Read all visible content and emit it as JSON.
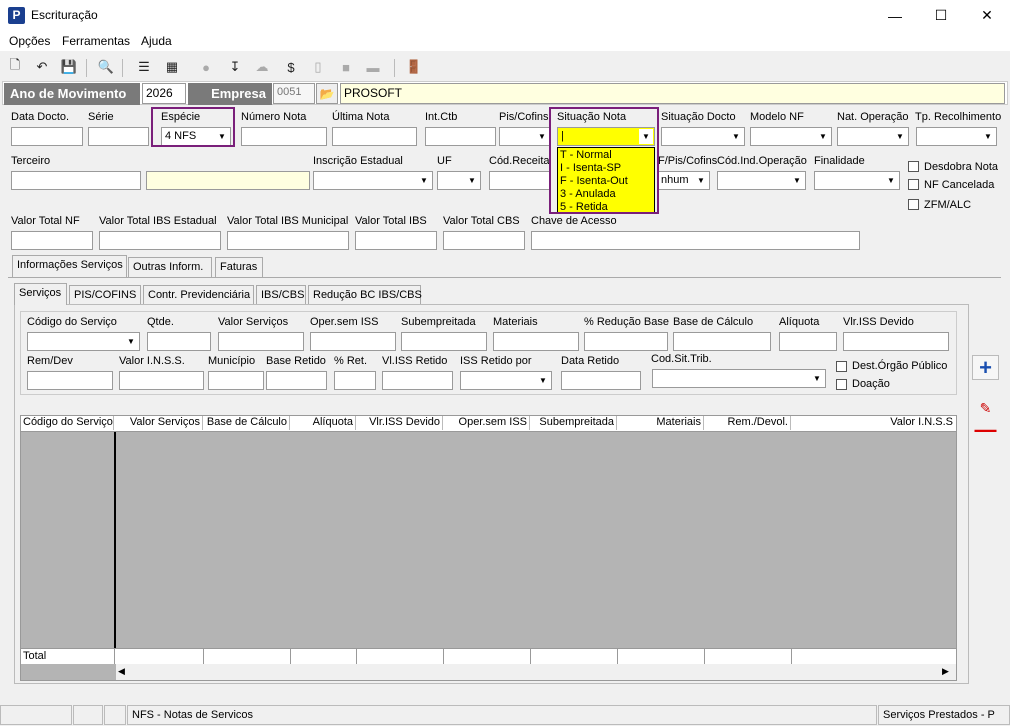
{
  "window": {
    "title": "Escrituração",
    "icon": "P"
  },
  "menu": [
    "Opções",
    "Ferramentas",
    "Ajuda"
  ],
  "header": {
    "ano_label": "Ano de Movimento",
    "ano_value": "2026",
    "empresa_label": "Empresa",
    "empresa_code": "0051",
    "empresa_name": "PROSOFT"
  },
  "row1": {
    "data_docto": "Data Docto.",
    "serie": "Série",
    "especie": "Espécie",
    "especie_value": "4 NFS",
    "numero_nota": "Número Nota",
    "ultima_nota": "Última Nota",
    "int_ctb": "Int.Ctb",
    "pis_cofins": "Pis/Cofins",
    "situacao_nota": "Situação Nota",
    "situacao_value": "|",
    "situacao_docto": "Situação Docto",
    "modelo_nf": "Modelo NF",
    "nat_operacao": "Nat. Operação",
    "tp_recolhimento": "Tp. Recolhimento"
  },
  "situacao_options": [
    "T - Normal",
    "I - Isenta-SP",
    "F - Isenta-Out",
    "3 - Anulada",
    "5 - Retida"
  ],
  "row2": {
    "terceiro": "Terceiro",
    "inscricao_estadual": "Inscrição Estadual",
    "uf": "UF",
    "cod_receita": "Cód.Receita",
    "f_pis_cofins": "F/Pis/Cofins",
    "f_pis_value": "nhum",
    "cod_ind_operacao": "Cód.Ind.Operação",
    "finalidade": "Finalidade"
  },
  "checks": {
    "desdobra_nota": "Desdobra Nota",
    "nf_cancelada": "NF Cancelada",
    "zfm_alc": "ZFM/ALC"
  },
  "row3": {
    "valor_total_nf": "Valor Total NF",
    "valor_total_ibs_estadual": "Valor Total IBS Estadual",
    "valor_total_ibs_municipal": "Valor Total IBS Municipal",
    "valor_total_ibs": "Valor Total IBS",
    "valor_total_cbs": "Valor Total CBS",
    "chave_acesso": "Chave de Acesso"
  },
  "main_tabs": [
    "Informações Serviços",
    "Outras Inform.",
    "Faturas"
  ],
  "sub_tabs": [
    "Serviços",
    "PIS/COFINS",
    "Contr. Previdenciária",
    "IBS/CBS",
    "Redução BC IBS/CBS"
  ],
  "servicos": {
    "codigo_servico": "Código do Serviço",
    "qtde": "Qtde.",
    "valor_servicos": "Valor Serviços",
    "oper_sem_iss": "Oper.sem ISS",
    "subempreitada": "Subempreitada",
    "materiais": "Materiais",
    "pct_reducao_base": "% Redução Base",
    "base_calculo": "Base de Cálculo",
    "aliquota": "Alíquota",
    "vlr_iss_devido": "Vlr.ISS Devido",
    "rem_dev": "Rem/Dev",
    "valor_inss": "Valor I.N.S.S.",
    "municipio": "Município",
    "base_retido": "Base Retido",
    "pct_ret": "% Ret.",
    "vl_iss_retido": "Vl.ISS Retido",
    "iss_retido_por": "ISS Retido por",
    "data_retido": "Data Retido",
    "cod_sit_trib": "Cod.Sit.Trib.",
    "dest_orgao_publico": "Dest.Órgão Público",
    "doacao": "Doação"
  },
  "grid": {
    "columns": [
      "Código do Serviço",
      "Valor Serviços",
      "Base de Cálculo",
      "Alíquota",
      "Vlr.ISS Devido",
      "Oper.sem ISS",
      "Subempreitada",
      "Materiais",
      "Rem./Devol.",
      "Valor I.N.S.S"
    ],
    "total_label": "Total"
  },
  "status": {
    "especie_desc": "NFS - Notas de Servicos",
    "right": "Serviços Prestados - P"
  }
}
